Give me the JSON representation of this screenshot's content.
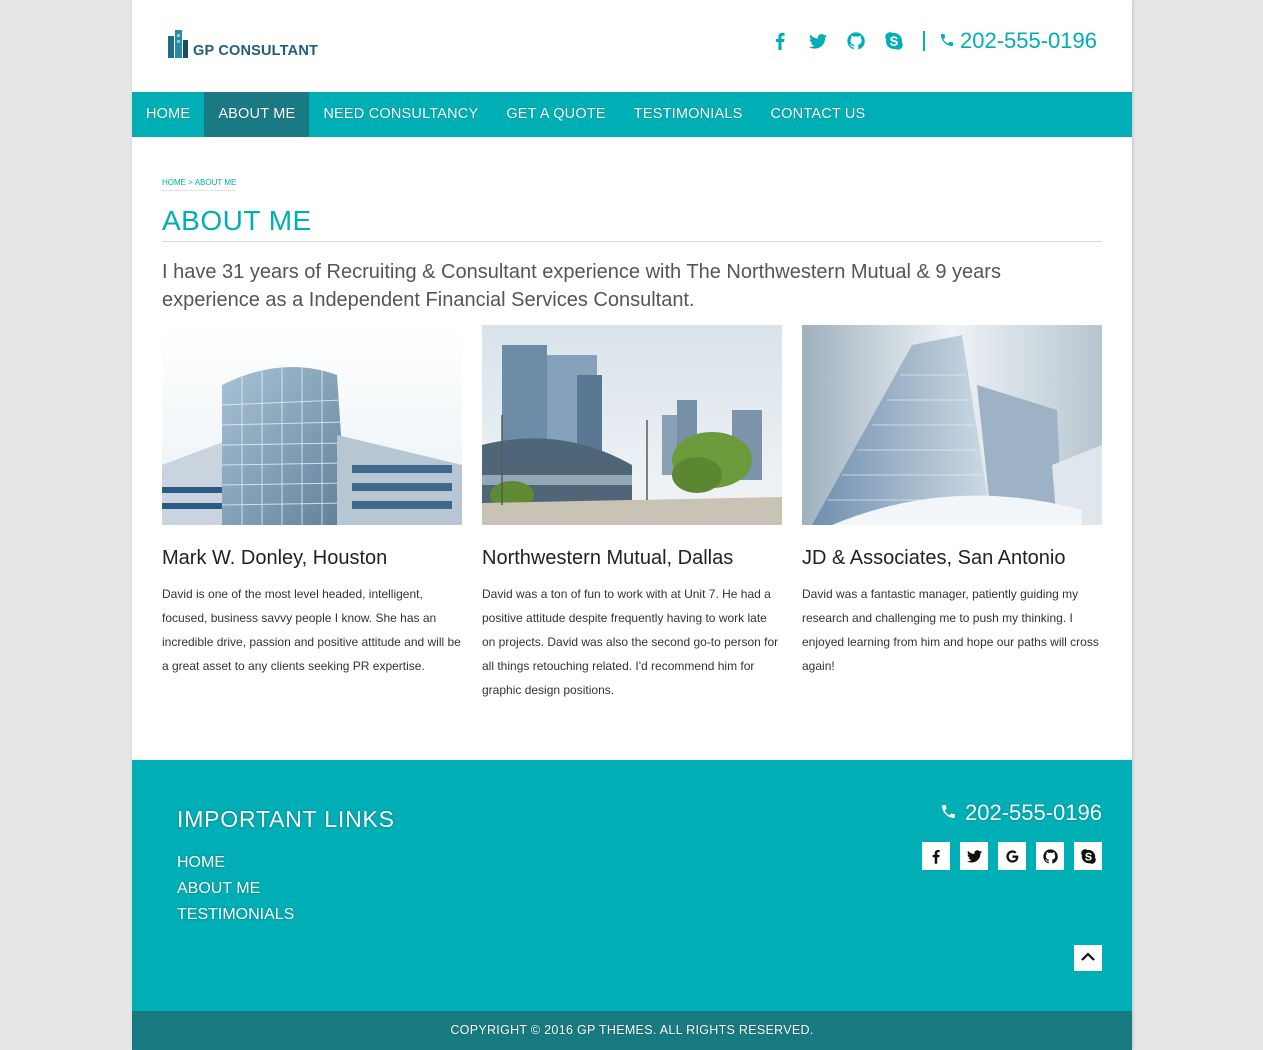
{
  "header": {
    "logo_text": "GP CONSULTANT",
    "social_icons": [
      "facebook-icon",
      "twitter-icon",
      "github-icon",
      "skype-icon"
    ],
    "phone": "202-555-0196"
  },
  "nav": {
    "items": [
      {
        "label": "HOME",
        "active": false
      },
      {
        "label": "ABOUT ME",
        "active": true
      },
      {
        "label": "NEED CONSULTANCY",
        "active": false
      },
      {
        "label": "GET A QUOTE",
        "active": false
      },
      {
        "label": "TESTIMONIALS",
        "active": false
      },
      {
        "label": "CONTACT US",
        "active": false
      }
    ]
  },
  "breadcrumb": {
    "home": "HOME",
    "separator": ">",
    "current": "ABOUT ME"
  },
  "main": {
    "title": "ABOUT ME",
    "intro": "I have 31 years of Recruiting & Consultant experience with The Northwestern Mutual & 9 years experience as a Independent Financial Services Consultant.",
    "cards": [
      {
        "title": "Mark W. Donley, Houston",
        "text": "David is one of the most level headed, intelligent, focused, business savvy people I know. She has an incredible drive, passion and positive attitude and will be a great asset to any clients seeking PR expertise."
      },
      {
        "title": "Northwestern Mutual, Dallas",
        "text": "David was a ton of fun to work with at Unit 7. He had a positive attitude despite frequently having to work late on projects. David was also the second go-to person for all things retouching related. I'd recommend him for graphic design positions."
      },
      {
        "title": "JD & Associates, San Antonio",
        "text": "David was a fantastic manager, patiently guiding my research and challenging me to push my thinking. I enjoyed learning from him and hope our paths will cross again!"
      }
    ]
  },
  "footer": {
    "heading": "IMPORTANT LINKS",
    "links": [
      "HOME",
      "ABOUT ME",
      "TESTIMONIALS"
    ],
    "phone": "202-555-0196",
    "social_icons": [
      "facebook-icon",
      "twitter-icon",
      "google-icon",
      "github-icon",
      "skype-icon"
    ],
    "copyright": "COPYRIGHT © 2016 GP THEMES. ALL RIGHTS RESERVED."
  },
  "colors": {
    "accent": "#00aeb6",
    "nav_active": "#1a7a84",
    "copyright_bar": "#167a80",
    "background": "#e6e6e6"
  }
}
